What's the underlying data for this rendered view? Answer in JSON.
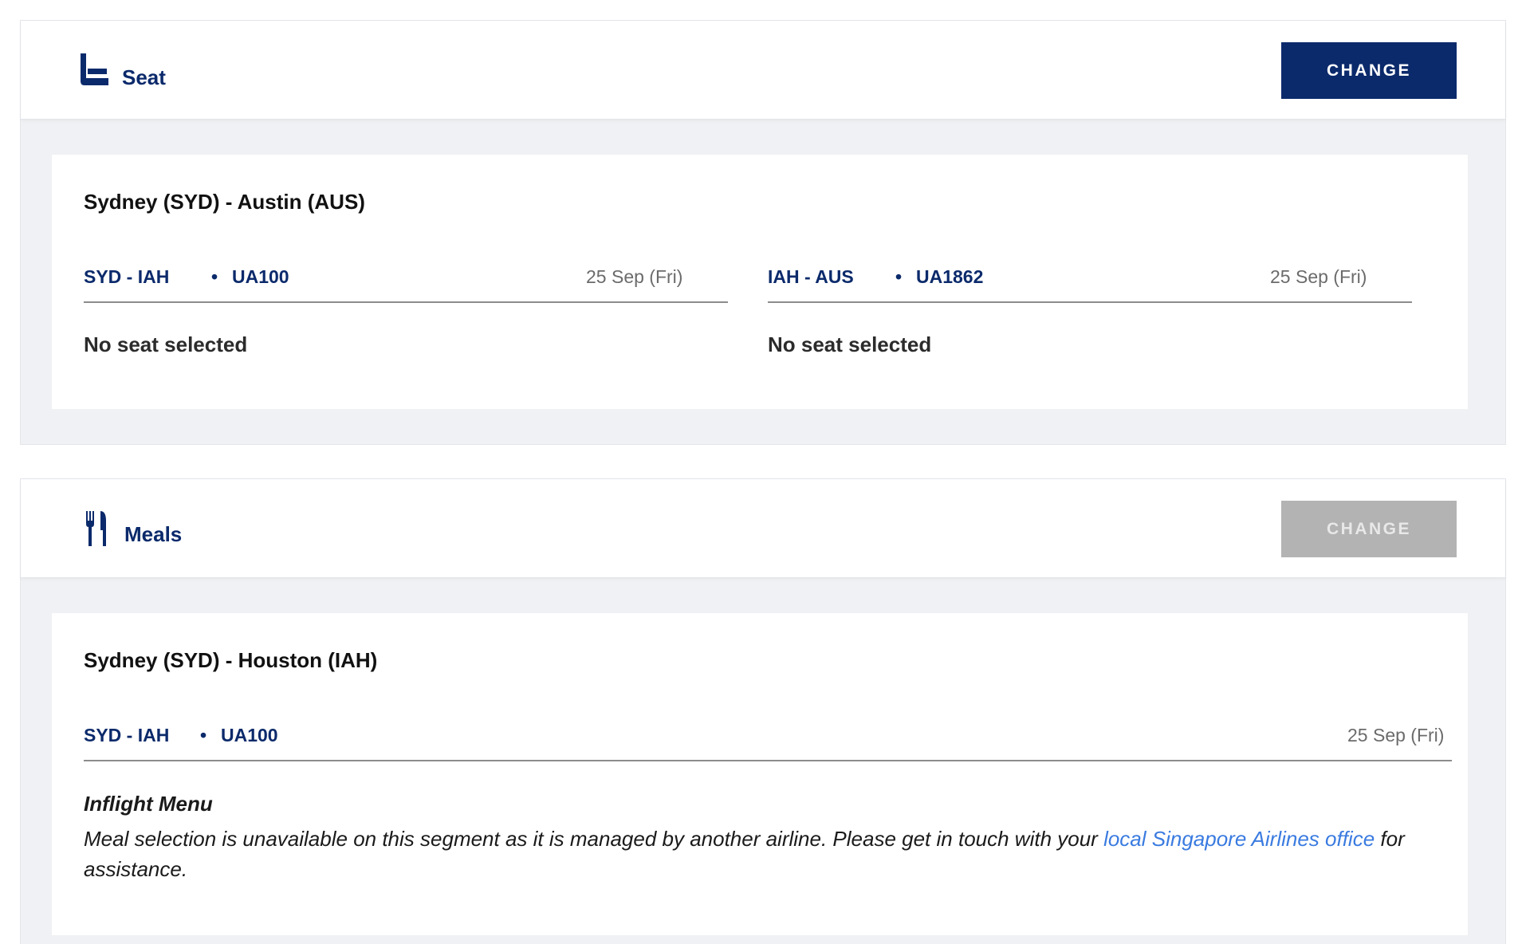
{
  "seat_section": {
    "title": "Seat",
    "icon": "seat-icon",
    "change_label": "CHANGE",
    "route_title": "Sydney (SYD) - Austin (AUS)",
    "segments": [
      {
        "route": "SYD - IAH",
        "flight": "UA100",
        "date": "25 Sep (Fri)",
        "status": "No seat selected"
      },
      {
        "route": "IAH - AUS",
        "flight": "UA1862",
        "date": "25 Sep (Fri)",
        "status": "No seat selected"
      }
    ]
  },
  "meals_section": {
    "title": "Meals",
    "icon": "fork-knife-icon",
    "change_label": "CHANGE",
    "change_disabled": true,
    "route_title": "Sydney (SYD) - Houston (IAH)",
    "segment": {
      "route": "SYD - IAH",
      "flight": "UA100",
      "date": "25 Sep (Fri)"
    },
    "menu_title": "Inflight Menu",
    "menu_text_before": "Meal selection is unavailable on this segment as it is managed by another airline. Please get in touch with your ",
    "menu_link": "local Singapore Airlines office",
    "menu_text_after": " for assistance."
  },
  "colors": {
    "brand_navy": "#0b2a6b",
    "disabled_gray": "#b3b3b3",
    "link_blue": "#3a7be0",
    "panel_bg": "#f0f1f4"
  }
}
